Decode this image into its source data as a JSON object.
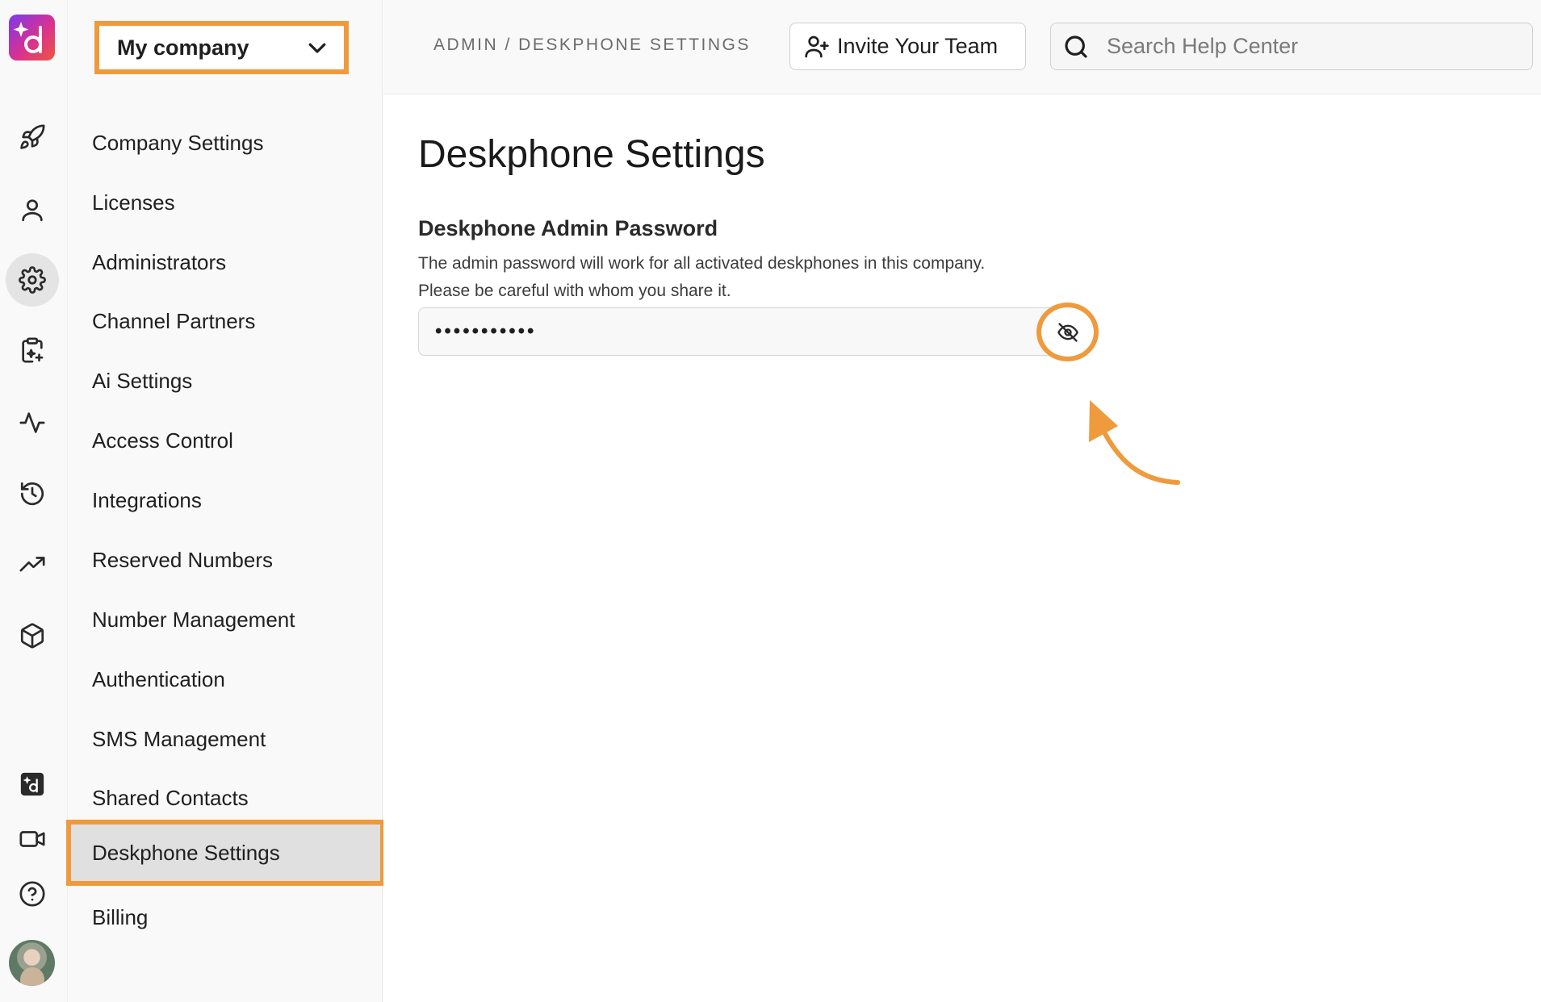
{
  "sidebar": {
    "company_selector": "My company",
    "items": [
      {
        "label": "Company Settings"
      },
      {
        "label": "Licenses"
      },
      {
        "label": "Administrators"
      },
      {
        "label": "Channel Partners"
      },
      {
        "label": "Ai Settings"
      },
      {
        "label": "Access Control"
      },
      {
        "label": "Integrations"
      },
      {
        "label": "Reserved Numbers"
      },
      {
        "label": "Number Management"
      },
      {
        "label": "Authentication"
      },
      {
        "label": "SMS Management"
      },
      {
        "label": "Shared Contacts"
      },
      {
        "label": "Deskphone Settings"
      },
      {
        "label": "Billing"
      }
    ],
    "active_item": "Deskphone Settings"
  },
  "rail": {
    "icons": [
      "rocket-icon",
      "person-icon",
      "gear-icon",
      "clipboard-sparkle-icon",
      "activity-icon",
      "history-icon",
      "trending-up-icon",
      "cube-icon",
      "dialpad-ai-icon",
      "video-icon",
      "help-icon"
    ],
    "active_icon": "gear-icon"
  },
  "header": {
    "breadcrumb": "ADMIN / DESKPHONE SETTINGS",
    "invite_label": "Invite Your Team",
    "search_placeholder": "Search Help Center"
  },
  "main": {
    "title": "Deskphone Settings",
    "section_title": "Deskphone Admin Password",
    "description_line1": "The admin password will work for all activated deskphones in this company.",
    "description_line2": "Please be careful with whom you share it.",
    "password_masked": "•••••••••••"
  },
  "colors": {
    "highlight": "#ef9a3c",
    "active_bg": "#e0e0e0"
  }
}
